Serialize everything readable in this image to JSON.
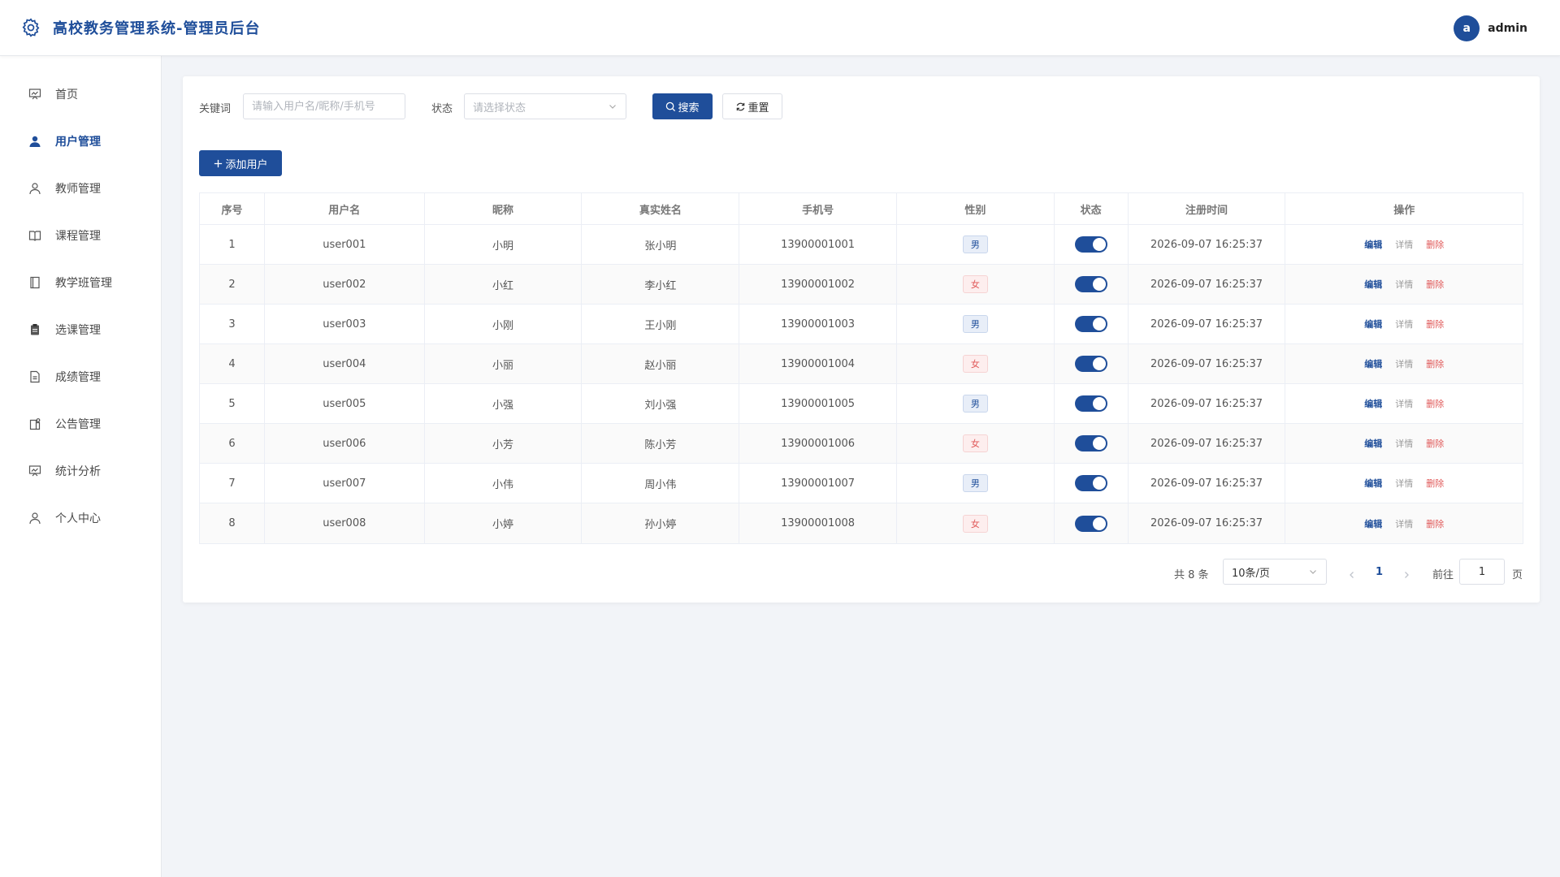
{
  "app": {
    "title": "高校教务管理系统-管理员后台"
  },
  "user": {
    "avatar_letter": "a",
    "name": "admin"
  },
  "sidebar": {
    "items": [
      {
        "label": "首页",
        "icon": "chart-board-icon",
        "active": false
      },
      {
        "label": "用户管理",
        "icon": "user-filled-icon",
        "active": true
      },
      {
        "label": "教师管理",
        "icon": "user-icon",
        "active": false
      },
      {
        "label": "课程管理",
        "icon": "book-icon",
        "active": false
      },
      {
        "label": "教学班管理",
        "icon": "notebook-icon",
        "active": false
      },
      {
        "label": "选课管理",
        "icon": "clipboard-icon",
        "active": false
      },
      {
        "label": "成绩管理",
        "icon": "document-icon",
        "active": false
      },
      {
        "label": "公告管理",
        "icon": "notice-icon",
        "active": false
      },
      {
        "label": "统计分析",
        "icon": "chart-board-icon",
        "active": false
      },
      {
        "label": "个人中心",
        "icon": "user-icon",
        "active": false
      }
    ]
  },
  "filter": {
    "keyword_label": "关键词",
    "keyword_placeholder": "请输入用户名/昵称/手机号",
    "status_label": "状态",
    "status_placeholder": "请选择状态",
    "search_label": "搜索",
    "reset_label": "重置"
  },
  "toolbar": {
    "add_label": "添加用户"
  },
  "table": {
    "headers": [
      "序号",
      "用户名",
      "昵称",
      "真实姓名",
      "手机号",
      "性别",
      "状态",
      "注册时间",
      "操作"
    ],
    "ops": {
      "edit": "编辑",
      "detail": "详情",
      "delete": "删除"
    },
    "rows": [
      {
        "no": "1",
        "username": "user001",
        "nickname": "小明",
        "realname": "张小明",
        "phone": "13900001001",
        "gender": "男",
        "enabled": true,
        "time": "2026-09-07 16:25:37"
      },
      {
        "no": "2",
        "username": "user002",
        "nickname": "小红",
        "realname": "李小红",
        "phone": "13900001002",
        "gender": "女",
        "enabled": true,
        "time": "2026-09-07 16:25:37"
      },
      {
        "no": "3",
        "username": "user003",
        "nickname": "小刚",
        "realname": "王小刚",
        "phone": "13900001003",
        "gender": "男",
        "enabled": true,
        "time": "2026-09-07 16:25:37"
      },
      {
        "no": "4",
        "username": "user004",
        "nickname": "小丽",
        "realname": "赵小丽",
        "phone": "13900001004",
        "gender": "女",
        "enabled": true,
        "time": "2026-09-07 16:25:37"
      },
      {
        "no": "5",
        "username": "user005",
        "nickname": "小强",
        "realname": "刘小强",
        "phone": "13900001005",
        "gender": "男",
        "enabled": true,
        "time": "2026-09-07 16:25:37"
      },
      {
        "no": "6",
        "username": "user006",
        "nickname": "小芳",
        "realname": "陈小芳",
        "phone": "13900001006",
        "gender": "女",
        "enabled": true,
        "time": "2026-09-07 16:25:37"
      },
      {
        "no": "7",
        "username": "user007",
        "nickname": "小伟",
        "realname": "周小伟",
        "phone": "13900001007",
        "gender": "男",
        "enabled": true,
        "time": "2026-09-07 16:25:37"
      },
      {
        "no": "8",
        "username": "user008",
        "nickname": "小婷",
        "realname": "孙小婷",
        "phone": "13900001008",
        "gender": "女",
        "enabled": true,
        "time": "2026-09-07 16:25:37"
      }
    ]
  },
  "pagination": {
    "total_text": "共 8 条",
    "page_size": "10条/页",
    "current_page": "1",
    "goto_label": "前往",
    "goto_value": "1",
    "page_suffix": "页"
  },
  "colors": {
    "primary": "#1f4e9a",
    "danger": "#e05858",
    "background": "#f2f4f8"
  }
}
